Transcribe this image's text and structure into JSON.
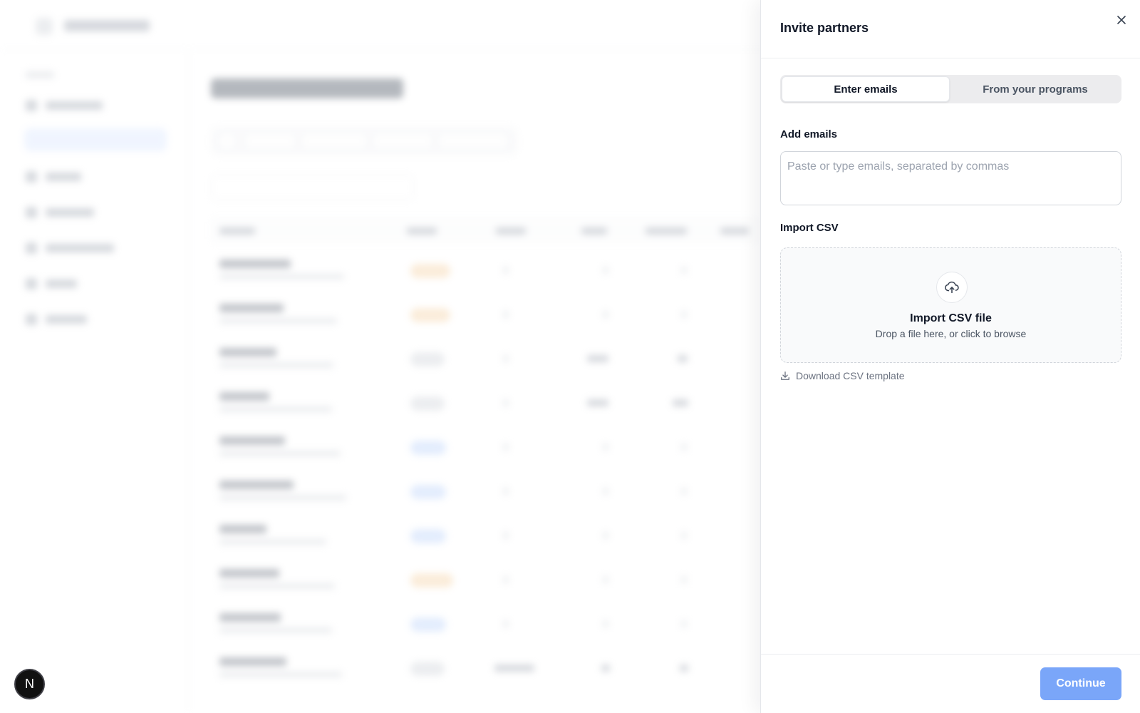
{
  "drawer": {
    "title": "Invite partners",
    "tabs": [
      {
        "label": "Enter emails",
        "active": true
      },
      {
        "label": "From your programs",
        "active": false
      }
    ],
    "add_emails": {
      "label": "Add emails",
      "placeholder": "Paste or type emails, separated by commas",
      "value": ""
    },
    "import_csv": {
      "label": "Import CSV",
      "dropzone_title": "Import CSV file",
      "dropzone_subtitle": "Drop a file here, or click to browse",
      "upload_icon": "cloud-upload-icon"
    },
    "download_template": {
      "label": "Download CSV template",
      "icon": "download-icon"
    },
    "footer": {
      "continue_label": "Continue"
    }
  },
  "dev_badge": {
    "label": "N"
  },
  "colors": {
    "primary_button": "#7aa6f9",
    "tab_track": "#ececee",
    "border": "#d1d5db"
  }
}
